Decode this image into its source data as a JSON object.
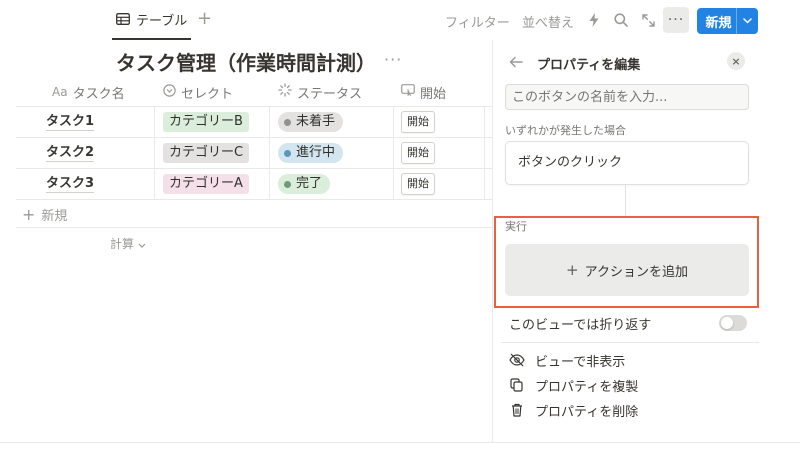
{
  "toolbar": {
    "view_tab_label": "テーブル",
    "add_view": "+",
    "filter_label": "フィルター",
    "sort_label": "並べ替え",
    "more": "···",
    "new_label": "新規",
    "icons": [
      "table-icon",
      "lightning-icon",
      "search-icon",
      "expand-icon",
      "more-icon",
      "chevron-down-icon"
    ]
  },
  "database": {
    "title": "タスク管理（作業時間計測）",
    "title_more": "···"
  },
  "table": {
    "columns": [
      {
        "icon": "Aa",
        "label": "タスク名"
      },
      {
        "icon": "select-icon",
        "label": "セレクト"
      },
      {
        "icon": "status-icon",
        "label": "ステータス"
      },
      {
        "icon": "button-icon",
        "label": "開始"
      }
    ],
    "rows": [
      {
        "name": "タスク1",
        "category": "カテゴリーB",
        "status": "未着手",
        "button": "開始"
      },
      {
        "name": "タスク2",
        "category": "カテゴリーC",
        "status": "進行中",
        "button": "開始"
      },
      {
        "name": "タスク3",
        "category": "カテゴリーA",
        "status": "完了",
        "button": "開始"
      }
    ],
    "new_row": "新規",
    "calc": "計算"
  },
  "colors": {
    "category_b": "#dbeddb",
    "category_c": "#e3e2e0",
    "category_a": "#f5e0e9",
    "status_not_started_bg": "#e3e2e0",
    "status_not_started_dot": "#91918e",
    "status_in_progress_bg": "#d3e5ef",
    "status_in_progress_dot": "#5b97bd",
    "status_done_bg": "#dbeddb",
    "status_done_dot": "#6c9b7d",
    "accent": "#2383e2",
    "highlight": "#e8603f"
  },
  "panel": {
    "title": "プロパティを編集",
    "close": "×",
    "name_placeholder": "このボタンの名前を入力...",
    "when_label": "いずれかが発生した場合",
    "trigger": "ボタンのクリック",
    "exec_label": "実行",
    "add_action": "アクションを追加",
    "wrap_label": "このビューでは折り返す",
    "menu": [
      {
        "icon": "eye-slash-icon",
        "label": "ビューで非表示"
      },
      {
        "icon": "duplicate-icon",
        "label": "プロパティを複製"
      },
      {
        "icon": "trash-icon",
        "label": "プロパティを削除"
      }
    ]
  }
}
